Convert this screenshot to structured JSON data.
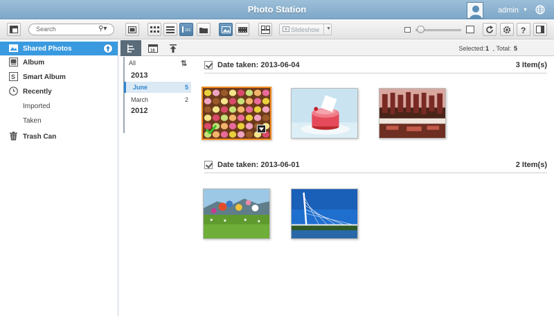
{
  "app": {
    "title": "Photo Station",
    "user": "admin"
  },
  "toolbar": {
    "search_placeholder": "Search",
    "slideshow_label": "Slideshow",
    "zoom_level": 0.1
  },
  "sidebar": {
    "items": [
      {
        "label": "Shared Photos",
        "active": true,
        "icon": "shared-photos-icon"
      },
      {
        "label": "Album",
        "icon": "album-icon"
      },
      {
        "label": "Smart Album",
        "icon": "smart-album-icon"
      },
      {
        "label": "Recently",
        "icon": "recently-clock-icon"
      },
      {
        "label": "Imported",
        "sub": true
      },
      {
        "label": "Taken",
        "sub": true
      },
      {
        "label": "Trash Can",
        "icon": "trash-can-icon"
      }
    ]
  },
  "timeline": {
    "all_label": "All",
    "years": [
      {
        "year": "2013",
        "months": [
          {
            "name": "June",
            "count": "5",
            "active": true
          },
          {
            "name": "March",
            "count": "2"
          }
        ]
      },
      {
        "year": "2012",
        "months": []
      }
    ]
  },
  "status": {
    "selected_label": "Selected:",
    "selected": "1",
    "total_label": ", Total:",
    "total": "5"
  },
  "groups": [
    {
      "label": "Date taken: 2013-06-04",
      "count": "3 Item(s)",
      "photos": [
        "macarons",
        "pink-cake",
        "market-stall"
      ]
    },
    {
      "label": "Date taken: 2013-06-01",
      "count": "2 Item(s)",
      "photos": [
        "hot-air-balloons",
        "bridge"
      ]
    }
  ],
  "colors": {
    "accent": "#3a9ae0",
    "titlebar": "#8db3d3",
    "selection": "#ef8a1f"
  }
}
